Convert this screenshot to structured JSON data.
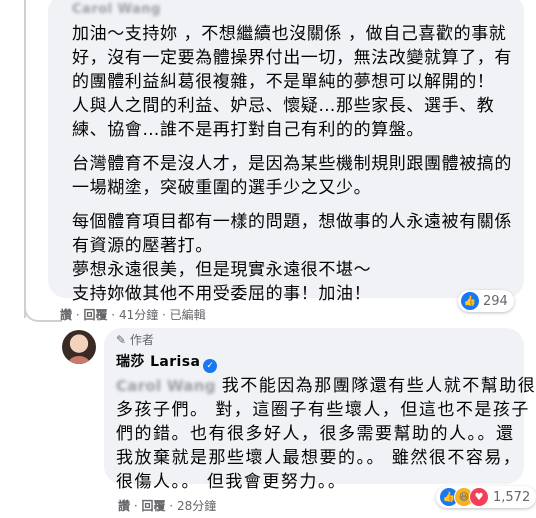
{
  "comment1": {
    "author_name": "Carol Wang",
    "lines": [
      "加油～支持妳 ，不想繼續也沒關係 ，做自己喜歡的事就",
      "好，沒有一定要為體操界付出一切，無法改變就算了，有",
      "的團體利益糾葛很複雜，不是單純的夢想可以解開的！",
      "人與人之間的利益、妒忌、懷疑…那些家長、選手、教",
      "練、協會…誰不是再打對自己有利的的算盤。",
      "台灣體育不是沒人才，是因為某些機制規則跟團體被搞的",
      "一場糊塗，突破重圍的選手少之又少。",
      "每個體育項目都有一樣的問題，想做事的人永遠被有關係",
      "有資源的壓著打。",
      "夢想永遠很美，但是現實永遠很不堪～",
      "支持妳做其他不用受委屈的事！加油！"
    ],
    "actions": {
      "like": "讚",
      "reply": "回覆",
      "time": "41分鐘",
      "edited": "已編輯"
    },
    "reaction_count": "294"
  },
  "comment2": {
    "author_tag": "作者",
    "author_name": "瑞莎 Larisa",
    "mention": "Carol Wang",
    "lines": [
      "我不能因為那團隊還有些人就不幫助很",
      "多孩子們。 對，這圈子有些壞人，但這也不是孩子",
      "們的錯。也有很多好人，很多需要幫助的人。。還",
      "我放棄就是那些壞人最想要的。。  雖然很不容易，",
      "很傷人。。 但我會更努力。。"
    ],
    "actions": {
      "like": "讚",
      "reply": "回覆",
      "time": "28分鐘"
    },
    "reaction_count": "1,572"
  },
  "colors": {
    "bubble": "#f0f2f5",
    "meta": "#65676b",
    "accent": "#1877f2"
  },
  "icons": [
    "like-icon",
    "verified-icon",
    "haha-icon",
    "love-icon",
    "author-pen-icon"
  ]
}
